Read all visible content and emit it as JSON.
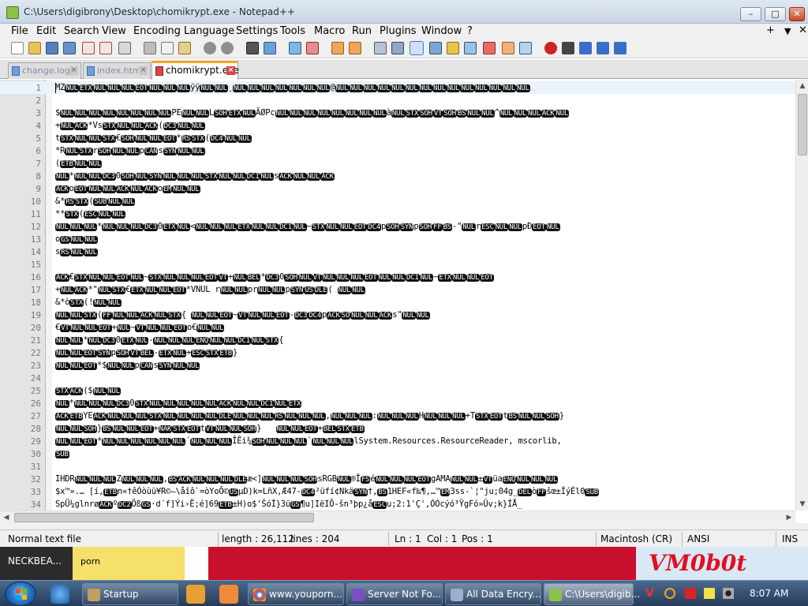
{
  "window": {
    "title": "C:\\Users\\digibrony\\Desktop\\chomikrypt.exe - Notepad++",
    "minimize": "–",
    "maximize": "□",
    "close": "✕"
  },
  "menu": {
    "items": [
      "File",
      "Edit",
      "Search",
      "View",
      "Encoding",
      "Language",
      "Settings",
      "Tools",
      "Macro",
      "Run",
      "Plugins",
      "Window",
      "?"
    ],
    "right": [
      "+",
      "▼",
      "✕"
    ]
  },
  "tabs": [
    {
      "label": "change.log",
      "active": false
    },
    {
      "label": "index.html",
      "active": false
    },
    {
      "label": "chomikrypt.exe",
      "active": true
    }
  ],
  "editor": {
    "lines": [
      {
        "n": "1",
        "t": "MZ[NUL][ETX][NUL][NUL][NUL][EOT][NUL][NUL][NUL]ÿÿ[NUL][NUL]¸[NUL][NUL][NUL][NUL][NUL][NUL][NUL]@[NUL][NUL][NUL][NUL][NUL][NUL][NUL][NUL][NUL][NUL][NUL][NUL][NUL][NUL]"
      },
      {
        "n": "2",
        "t": ""
      },
      {
        "n": "3",
        "t": "$[NUL][NUL][NUL][NUL][NUL][NUL][NUL][NUL]PE[NUL][NUL]L[SOH][ETX][NUL]ÄØPc[NUL][NUL][NUL][NUL][NUL][NUL][NUL][NUL]à[NUL][STX][SOH][VT][SOH][BS][NUL][NUL]^[NUL][NUL][NUL][ACK][NUL]"
      },
      {
        "n": "4",
        "t": "+[NUL][ACK]*Vs[STX][NUL][NUL][ACK]([DC3][NUL][NUL]"
      },
      {
        "n": "5",
        "t": "t[STX][NUL][NUL][STX]€[SOH][NUL][NUL][EOT]*[RS][STX]([DC4][NUL][NUL]"
      },
      {
        "n": "6",
        "t": "*R[NUL][STX]r[SOH][NUL][NUL]p[CAN]s[SYN][NUL][NUL]"
      },
      {
        "n": "7",
        "t": "([ETB][NUL][NUL]"
      },
      {
        "n": "8",
        "t": "[NUL]*[NUL][NUL][DC3]0[SOH][NUL][SYN][NUL][NUL][NUL][STX][NUL][NUL][DC1][NUL]s[ACK][NUL][NUL][ACK]"
      },
      {
        "n": "9",
        "t": "[ACK]o[EOT][NUL][NUL][ACK][NUL][ACK]o[EM][NUL][NUL]"
      },
      {
        "n": "10",
        "t": "&*[RS][STX]([SUB][NUL][NUL]"
      },
      {
        "n": "11",
        "t": "**[STX]([ESC][NUL][NUL]"
      },
      {
        "n": "12",
        "t": "[NUL][NUL][NUL]*[NUL][NUL][NUL][DC3]0[ETX][NUL]<[NUL][NUL][NUL][ETX][NUL][NUL][DC1][NUL]~[STX][NUL][NUL][EOT][DC4]p[SOH][SYN]p[SOH][FF][BS]-\"[NUL]r[ESC][NUL][NUL]pÐ[EOT][NUL]"
      },
      {
        "n": "13",
        "t": "o[GS][NUL][NUL]"
      },
      {
        "n": "14",
        "t": "s[RS][NUL][NUL]"
      },
      {
        "n": "15",
        "t": ""
      },
      {
        "n": "16",
        "t": "[ACK]€[STX][NUL][NUL][EOT][NUL]~[STX][NUL][NUL][NUL][EOT][VT]+[NUL][BEL]*[DC3]0[SOH][NUL][VT][NUL][NUL][NUL][EOT][NUL][NUL][DC1][NUL]~[ETX][NUL][NUL][EOT]"
      },
      {
        "n": "17",
        "t": "+[NUL][ACK]*\"[NUL][STX]€[ETX][NUL][NUL][EOT]*VNUL r[NUL][NUL]pr[NUL][NUL]p[SYN][US][DLE]( [NUL][NUL]"
      },
      {
        "n": "18",
        "t": "&*ò[STX](![NUL][NUL]"
      },
      {
        "n": "19",
        "t": "[NUL][NUL][STX]([FF][NUL][NUL][ACK][NUL][STX]{ [NUL][NUL][EOT]~[VT][NUL][NUL][EOT]-[DC3][DC4]p[ACK][SO][NUL][NUL][ACK]s\"[NUL][NUL]"
      },
      {
        "n": "20",
        "t": "€[VT][NUL][NUL][EOT]+[NUL]~[VT][NUL][NUL][EOT]o€[NUL][NUL]"
      },
      {
        "n": "21",
        "t": "[NUL][NUL]*[NUL][DC3]0[ETX][NUL]-[NUL][NUL][NUL][ENQ][NUL][NUL][DC1][NUL][STX]{"
      },
      {
        "n": "22",
        "t": "[NUL][NUL][EOT][SYN]p[SOH][VT][BEL]-[ETX][NUL]+[ESC][STX][ETB]}"
      },
      {
        "n": "23",
        "t": "[NUL][NUL][EOT]*$[NUL][NUL]p[CAN]s[SYN][NUL][NUL]"
      },
      {
        "n": "24",
        "t": ""
      },
      {
        "n": "25",
        "t": "[STX][ACK]($[NUL][NUL]"
      },
      {
        "n": "26",
        "t": "[NUL]*[NUL][NUL][NUL][DC3]0[STX][NUL][NUL][NUL][NUL][NUL][ACK][NUL][NUL][DC1][NUL][ETX]"
      },
      {
        "n": "27",
        "t": "[ACK][ETB]YE[ACK][NUL][NUL][NUL][STX][NUL][NUL][NUL][NUL][DLE][NUL][NUL][NUL][RS][NUL][NUL][NUL],[NUL][NUL][NUL]:[NUL][NUL][NUL]H[NUL][NUL][NUL]+T[STX][EOT]t[BS][NUL][NUL][SOH]}"
      },
      {
        "n": "28",
        "t": "[NUL][NUL][SOH]}[BS][NUL][NUL][EOT]+[NAK][STX][EOT]t[VT][NUL][NUL][SOH]}   [NUL][NUL][EOT]+[BEL][STX][ETB]"
      },
      {
        "n": "29",
        "t": "[NUL][NUL][EOT]*[NUL][NUL][NUL][NUL][NUL][NUL]´[NUL][NUL][NUL]ÎÊi¾[SOH][NUL][NUL][NUL]`[NUL][NUL][NUL]lSystem.Resources.ResourceReader, mscorlib,"
      },
      {
        "n": "30",
        "t": "[SUB]"
      },
      {
        "n": "31",
        "t": ""
      },
      {
        "n": "32",
        "t": "IHDR[NUL][NUL][NUL]Z[NUL][NUL][NUL],[BS][ACK][NUL][NUL][NUL][DLE]æ<][NUL][NUL][NUL][SOH]sRGB[NUL]®Î[FS]é[NUL][NUL][NUL][EOT]gAMA[NUL][NUL]±[VT]üa[ENQ][NUL][NUL][NUL]"
      },
      {
        "n": "33",
        "t": "$x™».… [í,[ETB]n«†êÓòùü¥R©—\\åîô`=òYoÕ©[US]µD)k=LñX,Æ47-[DC4]²üfí¢Nkä[SYN]†,[BS]1HEF«f‰¶,…™[EM]3ss-`¦\"ju;04g_[DEL]ò[FF]šœ±ÍýÉl0[SUB]"
      },
      {
        "n": "34",
        "t": "SpÜ¼glnrø[ACK]º[DC2]Öß[GS]·d´f]Ýi›Ë;é]69[ETB]±H)o$'ŠóÍ}3ü[GS]¶u]IëIÕ-šn³þp¿å[ESC]u;2:1'Ç',ÓÓcýó³ŸgFó»Ûv;k}ÍÅ_"
      }
    ]
  },
  "status": {
    "doc_type": "Normal text file",
    "length": "length : 26,112",
    "lines": "lines : 204",
    "ln": "Ln : 1",
    "col": "Col : 1",
    "pos": "Pos : 1",
    "eol": "Macintosh (CR)",
    "encoding": "ANSI",
    "mode": "INS"
  },
  "desktop": {
    "label_left": "NECKBEA...",
    "label_mid": "porn",
    "label_right": "VM0b0t"
  },
  "taskbar": {
    "tasks": [
      {
        "label": "Startup",
        "icon_color": "#c0a060"
      },
      {
        "label": "www.youporn...",
        "icon_color": "#e0a020"
      },
      {
        "label": "Server Not Fo...",
        "icon_color": "#7a4fc2"
      },
      {
        "label": "All Data Encry...",
        "icon_color": "#9ab0cc"
      },
      {
        "label": "C:\\Users\\digib...",
        "icon_color": "#8bc34a"
      }
    ],
    "clock": "8:07 AM"
  }
}
